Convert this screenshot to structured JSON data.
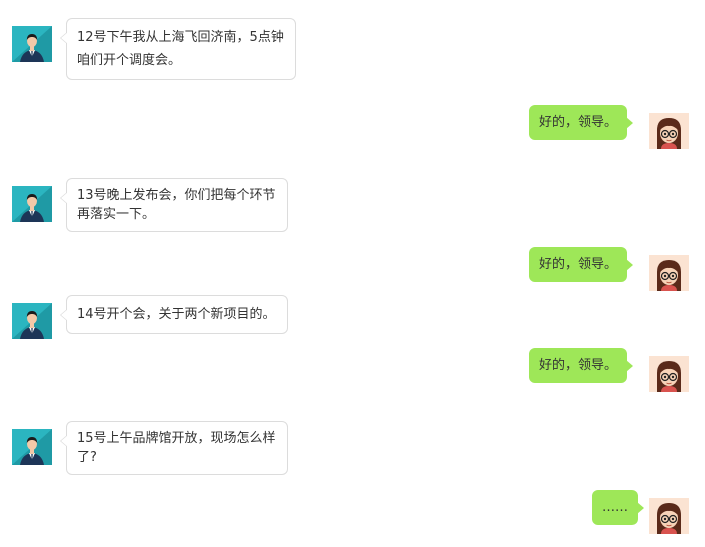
{
  "chat": {
    "messages": [
      {
        "sender": "leader",
        "text": "12号下午我从上海飞回济南，5点钟\n咱们开个调度会。"
      },
      {
        "sender": "me",
        "text": "好的，领导。"
      },
      {
        "sender": "leader",
        "text": "13号晚上发布会，你们把每个环节\n再落实一下。"
      },
      {
        "sender": "me",
        "text": "好的，领导。"
      },
      {
        "sender": "leader",
        "text": "14号开个会，关于两个新项目的。"
      },
      {
        "sender": "me",
        "text": "好的，领导。"
      },
      {
        "sender": "leader",
        "text": "15号上午品牌馆开放，现场怎么样\n了?"
      },
      {
        "sender": "me",
        "text": "……"
      }
    ]
  },
  "avatars": {
    "leader": {
      "icon": "businessman-avatar-icon",
      "background": "#2bb5c0"
    },
    "me": {
      "icon": "girl-with-glasses-avatar-icon",
      "background": "#fbe3d2"
    }
  },
  "colors": {
    "outgoing_bubble": "#9ee758",
    "incoming_bubble": "#ffffff",
    "incoming_border": "#dcdcdc",
    "text": "#333333"
  }
}
